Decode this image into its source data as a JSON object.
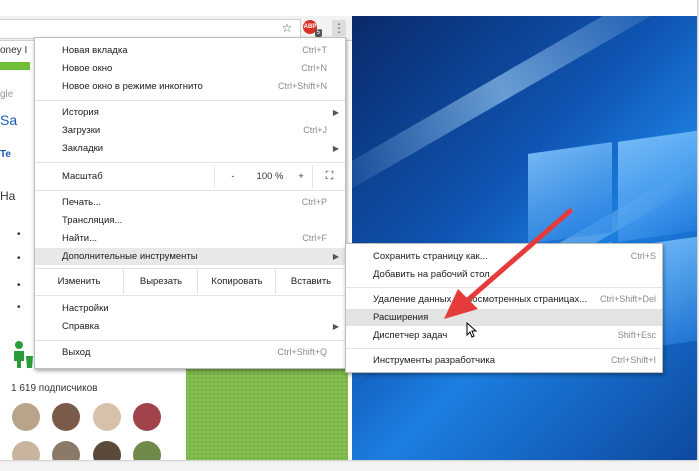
{
  "page_text": {
    "left_fragments": [
      "oney I",
      "gle",
      "Sa",
      "Te",
      "Ha"
    ],
    "subscribers": "1 619 подписчиков"
  },
  "menu": {
    "items": [
      {
        "label": "Новая вкладка",
        "shortcut": "Ctrl+T"
      },
      {
        "label": "Новое окно",
        "shortcut": "Ctrl+N"
      },
      {
        "label": "Новое окно в режиме инкогнито",
        "shortcut": "Ctrl+Shift+N"
      },
      {
        "label": "История",
        "shortcut": ""
      },
      {
        "label": "Загрузки",
        "shortcut": "Ctrl+J"
      },
      {
        "label": "Закладки",
        "shortcut": ""
      },
      {
        "label": "Печать...",
        "shortcut": "Ctrl+P"
      },
      {
        "label": "Трансляция...",
        "shortcut": ""
      },
      {
        "label": "Найти...",
        "shortcut": "Ctrl+F"
      },
      {
        "label": "Дополнительные инструменты",
        "shortcut": ""
      },
      {
        "label": "Настройки",
        "shortcut": ""
      },
      {
        "label": "Справка",
        "shortcut": ""
      },
      {
        "label": "Выход",
        "shortcut": "Ctrl+Shift+Q"
      }
    ],
    "zoom": {
      "label": "Масштаб",
      "minus": "-",
      "value": "100 %",
      "plus": "+",
      "fullscreen": "⛶"
    },
    "edit": {
      "label": "Изменить",
      "cut": "Вырезать",
      "copy": "Копировать",
      "paste": "Вставить"
    }
  },
  "submenu": {
    "items": [
      {
        "label": "Сохранить страницу как...",
        "shortcut": "Ctrl+S"
      },
      {
        "label": "Добавить на рабочий стол...",
        "shortcut": ""
      },
      {
        "label": "Удаление данных о просмотренных страницах...",
        "shortcut": "Ctrl+Shift+Del"
      },
      {
        "label": "Расширения",
        "shortcut": ""
      },
      {
        "label": "Диспетчер задач",
        "shortcut": "Shift+Esc"
      },
      {
        "label": "Инструменты разработчика",
        "shortcut": "Ctrl+Shift+I"
      }
    ]
  },
  "toolbar": {
    "star_icon": "star-icon",
    "extension_badge": "ABP",
    "extension_count": "5",
    "menu_icon": "⋮"
  },
  "colors": {
    "highlight": "#e8e8e8",
    "arrow": "#e63b3b",
    "desktop": "#0f55b3",
    "grass": "#7ab648"
  }
}
